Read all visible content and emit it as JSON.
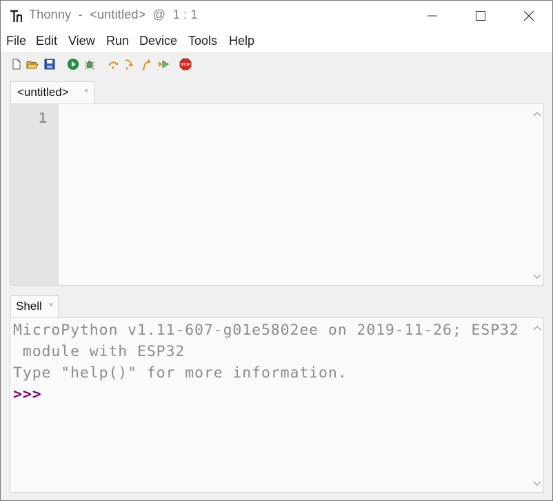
{
  "window": {
    "title": "Thonny  -  <untitled>  @  1 : 1",
    "icons": {
      "app": "thonny-logo-icon",
      "minimize": "minimize-icon",
      "maximize": "maximize-icon",
      "close": "close-icon"
    }
  },
  "menu": [
    "File",
    "Edit",
    "View",
    "Run",
    "Device",
    "Tools",
    "Help"
  ],
  "toolbar": [
    {
      "name": "new-file-icon"
    },
    {
      "name": "open-folder-icon"
    },
    {
      "name": "save-icon"
    },
    {
      "name": "run-icon"
    },
    {
      "name": "debug-icon"
    },
    {
      "name": "step-over-icon"
    },
    {
      "name": "step-into-icon"
    },
    {
      "name": "step-out-icon"
    },
    {
      "name": "resume-icon"
    },
    {
      "name": "stop-icon",
      "label": "STOP"
    }
  ],
  "editor": {
    "tab_label": "<untitled>",
    "tab_close": "×",
    "line_numbers": [
      "1"
    ],
    "content": ""
  },
  "shell": {
    "tab_label": "Shell",
    "tab_close": "×",
    "lines": [
      "MicroPython v1.11-607-g01e5802ee on 2019-11-26; ESP32",
      " module with ESP32",
      "Type \"help()\" for more information."
    ],
    "prompt": ">>>"
  },
  "colors": {
    "prompt": "#800080",
    "shell_text": "#8c8c8c",
    "gutter": "#e4e4e4",
    "stop": "#d9261c",
    "run": "#1a9a3a"
  }
}
